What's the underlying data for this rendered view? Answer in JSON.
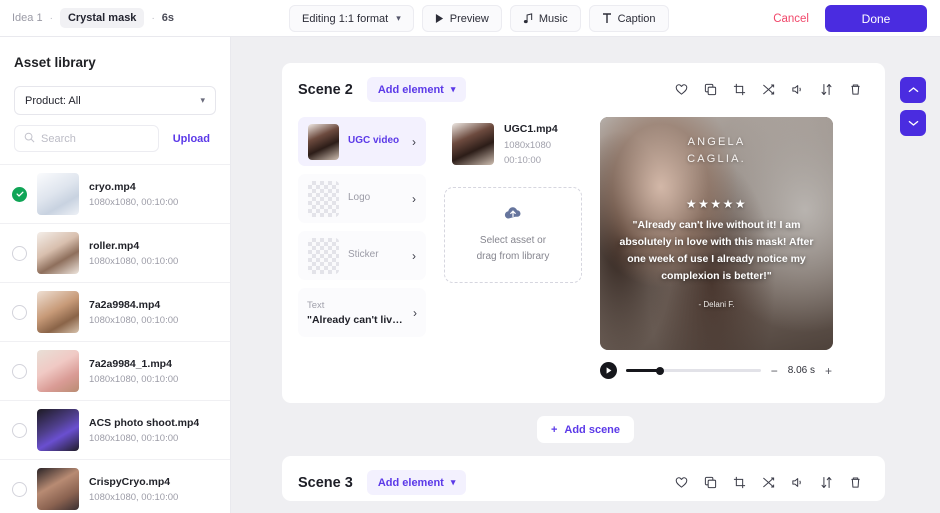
{
  "topbar": {
    "breadcrumb_idea": "Idea 1",
    "breadcrumb_separator": "·",
    "breadcrumb_project": "Crystal mask",
    "breadcrumb_duration": "6s",
    "format_button": "Editing 1:1 format",
    "preview_button": "Preview",
    "music_button": "Music",
    "caption_button": "Caption",
    "cancel_button": "Cancel",
    "done_button": "Done"
  },
  "sidebar": {
    "title": "Asset library",
    "product_filter": "Product: All",
    "search_placeholder": "Search",
    "search_value": "",
    "upload_label": "Upload",
    "assets": [
      {
        "name": "cryo.mp4",
        "meta": "1080x1080, 00:10:00",
        "selected": true,
        "art": "ph-cryo"
      },
      {
        "name": "roller.mp4",
        "meta": "1080x1080, 00:10:00",
        "selected": false,
        "art": "ph-roller"
      },
      {
        "name": "7a2a9984.mp4",
        "meta": "1080x1080, 00:10:00",
        "selected": false,
        "art": "ph-7a2a"
      },
      {
        "name": "7a2a9984_1.mp4",
        "meta": "1080x1080, 00:10:00",
        "selected": false,
        "art": "ph-7a2a1"
      },
      {
        "name": "ACS photo shoot.mp4",
        "meta": "1080x1080, 00:10:00",
        "selected": false,
        "art": "ph-acs"
      },
      {
        "name": "CrispyCryo.mp4",
        "meta": "1080x1080, 00:10:00",
        "selected": false,
        "art": "ph-crispy"
      }
    ]
  },
  "scene2": {
    "title": "Scene 2",
    "add_element_label": "Add element",
    "elements": [
      {
        "label": "UGC video",
        "selected": true
      },
      {
        "label": "Logo",
        "selected": false
      },
      {
        "label": "Sticker",
        "selected": false
      }
    ],
    "text_element": {
      "kind": "Text",
      "value": "\"Already can't live..\""
    },
    "selected_asset": {
      "name": "UGC1.mp4",
      "resolution": "1080x1080",
      "duration": "00:10:00"
    },
    "dropzone": {
      "line1": "Select asset or",
      "line2": "drag from library"
    },
    "preview": {
      "logo": "ANGELA\nCAGLIA.",
      "stars": "★★★★★",
      "quote": "\"Already can't live without it! I am absolutely in love with this mask! After one week of use I already notice my complexion is better!\"",
      "author": "- Delani F."
    },
    "player": {
      "time": "8.06 s",
      "progress_percent": 25,
      "minus": "−",
      "plus": "+"
    }
  },
  "add_scene_label": "Add scene",
  "scene3": {
    "title": "Scene 3",
    "add_element_label": "Add element"
  },
  "colors": {
    "accent_purple": "#4a2ce0",
    "link_purple": "#5b39e8",
    "cancel_red": "#f1476a",
    "check_green": "#10a557",
    "canvas_gray": "#efeff2"
  }
}
